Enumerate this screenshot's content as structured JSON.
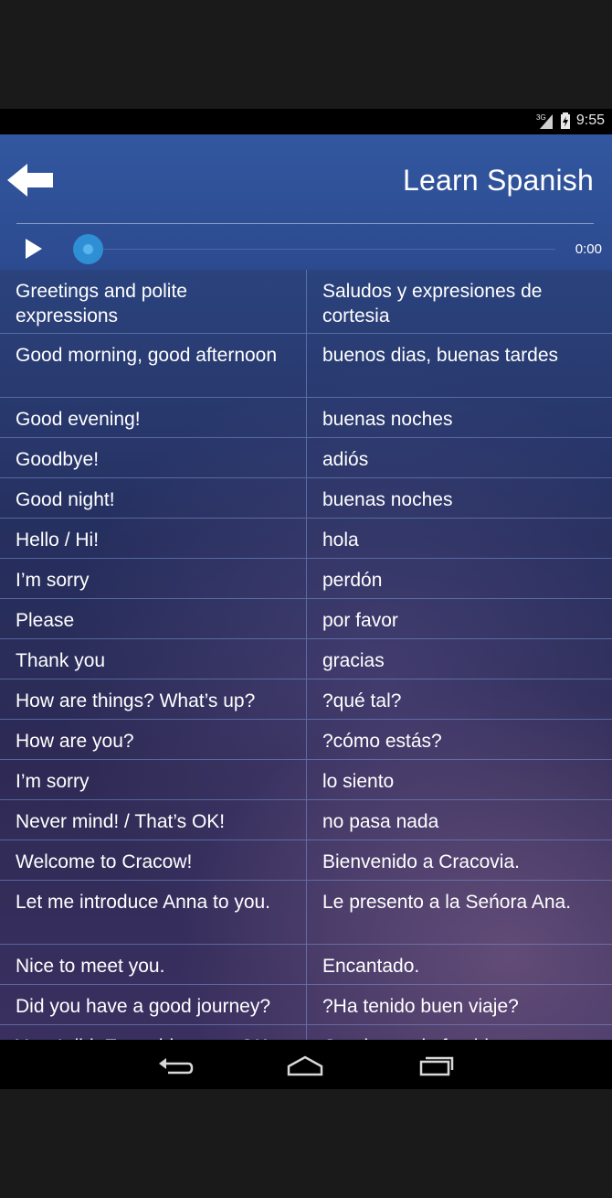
{
  "status_bar": {
    "network": "3G",
    "time": "9:55"
  },
  "header": {
    "title": "Learn Spanish",
    "back_icon": "arrow-left-icon"
  },
  "player": {
    "time": "0:00",
    "progress": 0.0
  },
  "colors": {
    "accent": "#2e8fd4",
    "header": "#3257a0"
  },
  "phrases": [
    {
      "en": "Greetings and polite expressions",
      "es": "Saludos y expresiones de cortesia"
    },
    {
      "en": "Good morning, good afternoon",
      "es": "buenos dias, buenas tardes"
    },
    {
      "en": "Good evening!",
      "es": "buenas noches"
    },
    {
      "en": "Goodbye!",
      "es": "adiós"
    },
    {
      "en": "Good night!",
      "es": "buenas noches"
    },
    {
      "en": "Hello / Hi!",
      "es": "hola"
    },
    {
      "en": "I’m sorry",
      "es": "perdón"
    },
    {
      "en": "Please",
      "es": "por favor"
    },
    {
      "en": "Thank you",
      "es": "gracias"
    },
    {
      "en": "How are things? What’s up?",
      "es": "?qué tal?"
    },
    {
      "en": "How are you?",
      "es": "?cómo estás?"
    },
    {
      "en": "I’m sorry",
      "es": "lo siento"
    },
    {
      "en": "Never mind! / That’s OK!",
      "es": "no pasa nada"
    },
    {
      "en": "Welcome to Cracow!",
      "es": "Bienvenido a Cracovia."
    },
    {
      "en": "Let me introduce Anna to you.",
      "es": "Le presento a la Seńora Ana."
    },
    {
      "en": "Nice to meet you.",
      "es": "Encantado."
    },
    {
      "en": "Did you have a good journey?",
      "es": "?Ha tenido buen viaje?"
    },
    {
      "en": "Yes, I did. Everything was OK.",
      "es": "Gracias, todo fue bien."
    }
  ],
  "nav": {
    "back_icon": "nav-back-icon",
    "home_icon": "nav-home-icon",
    "recents_icon": "nav-recents-icon"
  }
}
